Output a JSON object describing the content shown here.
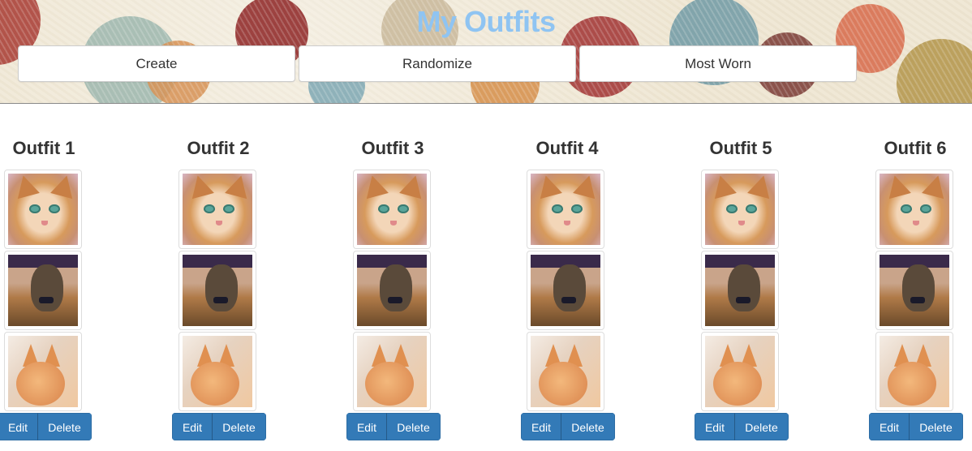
{
  "header": {
    "title": "My Outfits",
    "buttons": {
      "create": "Create",
      "randomize": "Randomize",
      "most_worn": "Most Worn"
    }
  },
  "outfits": [
    {
      "title": "Outfit 1",
      "edit": "Edit",
      "delete": "Delete"
    },
    {
      "title": "Outfit 2",
      "edit": "Edit",
      "delete": "Delete"
    },
    {
      "title": "Outfit 3",
      "edit": "Edit",
      "delete": "Delete"
    },
    {
      "title": "Outfit 4",
      "edit": "Edit",
      "delete": "Delete"
    },
    {
      "title": "Outfit 5",
      "edit": "Edit",
      "delete": "Delete"
    },
    {
      "title": "Outfit 6",
      "edit": "Edit",
      "delete": "Delete"
    }
  ],
  "colors": {
    "title": "#8fc4f2",
    "button_primary": "#337ab7",
    "heading": "#333333"
  }
}
